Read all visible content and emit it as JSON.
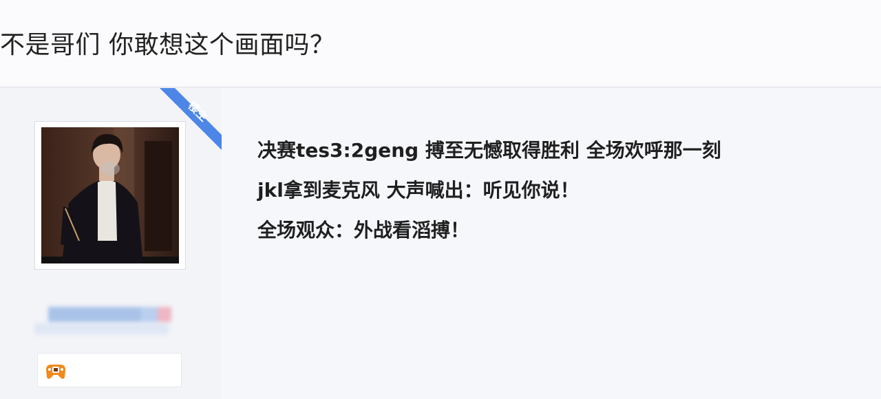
{
  "thread": {
    "title": "不是哥们 你敢想这个画面吗？"
  },
  "post": {
    "author_tag": "楼主",
    "lines": [
      "决赛tes3:2geng 搏至无憾取得胜利 全场欢呼那一刻",
      "jkl拿到麦克风 大声喊出：听见你说！",
      "全场观众：外战看滔搏！"
    ],
    "badge_icon": "gamepad-icon"
  },
  "colors": {
    "ribbon": "#4d86e6",
    "badge_orange": "#f08a1c",
    "page_bg": "#f6f7fb"
  }
}
